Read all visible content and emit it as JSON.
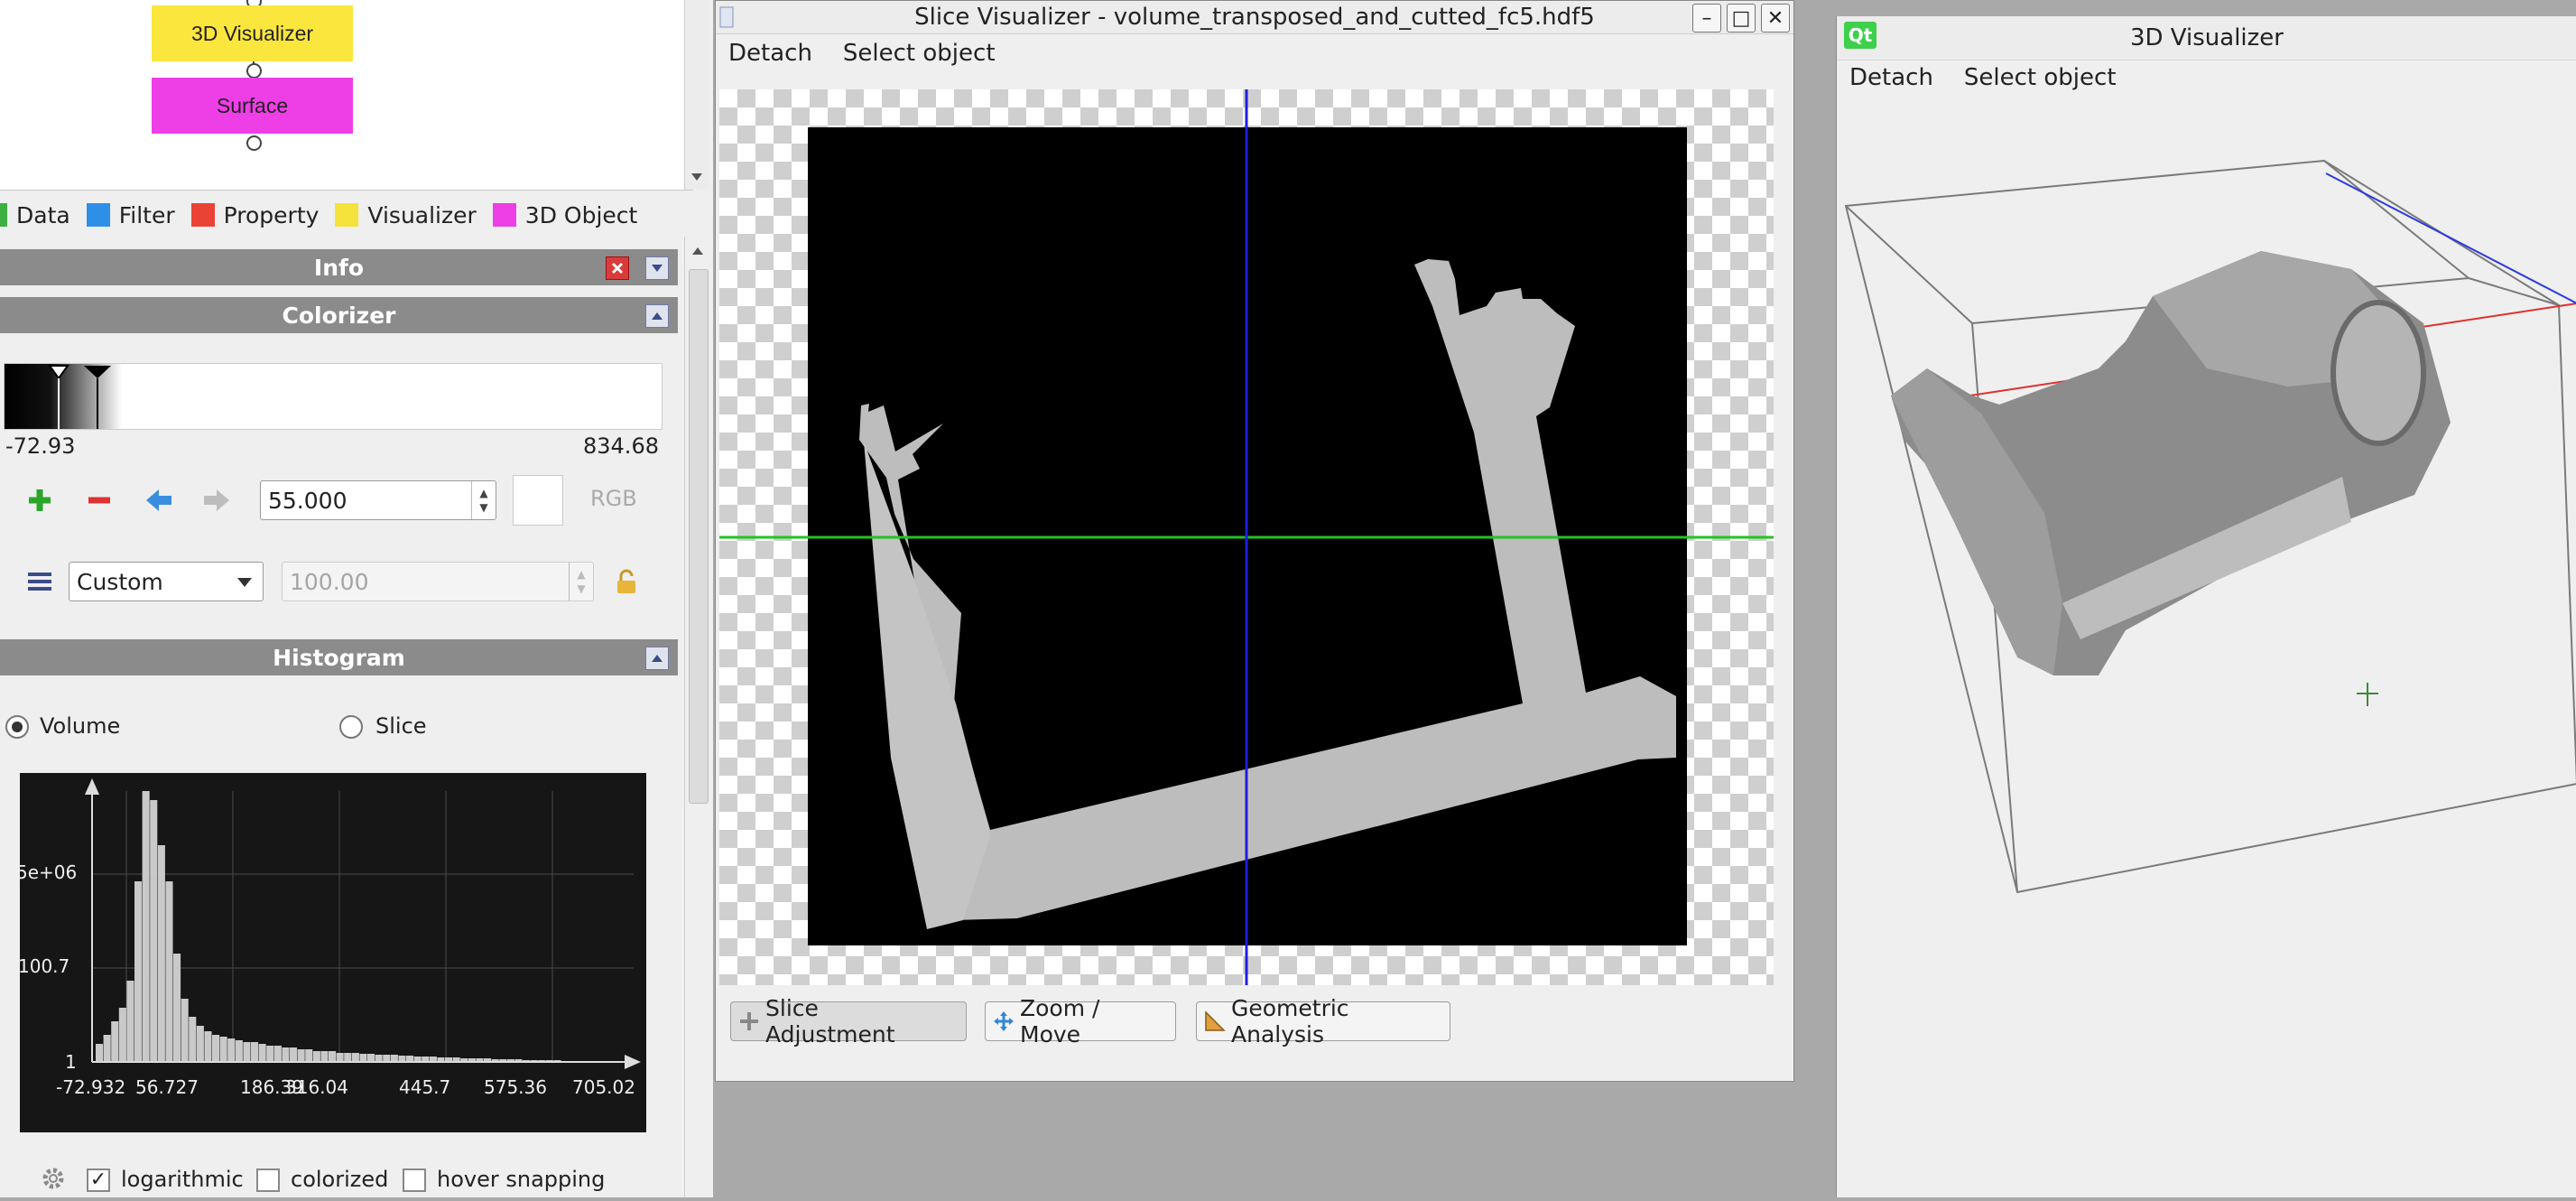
{
  "graph": {
    "node_visualizer": "3D Visualizer",
    "node_surface": "Surface"
  },
  "legend": [
    {
      "label": "Data",
      "color": "#3cb043"
    },
    {
      "label": "Filter",
      "color": "#2e8fe6"
    },
    {
      "label": "Property",
      "color": "#ea4335"
    },
    {
      "label": "Visualizer",
      "color": "#f5e23a"
    },
    {
      "label": "3D Object",
      "color": "#ee3ee6"
    }
  ],
  "panels": {
    "info_title": "Info",
    "colorizer_title": "Colorizer",
    "histogram_title": "Histogram"
  },
  "colorizer": {
    "min": "-72.93",
    "max": "834.68",
    "value": "55.000",
    "rgb_label": "RGB",
    "preset": "Custom",
    "opacity": "100.00"
  },
  "histogram": {
    "volume_label": "Volume",
    "slice_label": "Slice",
    "y_ticks": [
      "5e+06",
      "100.7",
      "1"
    ],
    "x_ticks": [
      "-72.932",
      "56.727",
      "186.39",
      "316.04",
      "445.7",
      "575.36",
      "705.02"
    ],
    "options": {
      "logarithmic": "logarithmic",
      "logarithmic_checked": true,
      "colorized": "colorized",
      "colorized_checked": false,
      "hover": "hover snapping",
      "hover_checked": false
    }
  },
  "slice_window": {
    "title": "Slice Visualizer - volume_transposed_and_cutted_fc5.hdf5",
    "menu_detach": "Detach",
    "menu_select": "Select object",
    "btn_slice": "Slice Adjustment",
    "btn_zoom": "Zoom / Move",
    "btn_geo": "Geometric Analysis"
  },
  "viz3d_window": {
    "title": "3D Visualizer",
    "qt_badge": "Qt",
    "menu_detach": "Detach",
    "menu_select": "Select object"
  },
  "colors": {
    "visualizer_node": "#fbe63d",
    "surface_node": "#ee3ee6",
    "crosshair_horizontal": "#22c422",
    "crosshair_vertical": "#1e1ee0"
  }
}
